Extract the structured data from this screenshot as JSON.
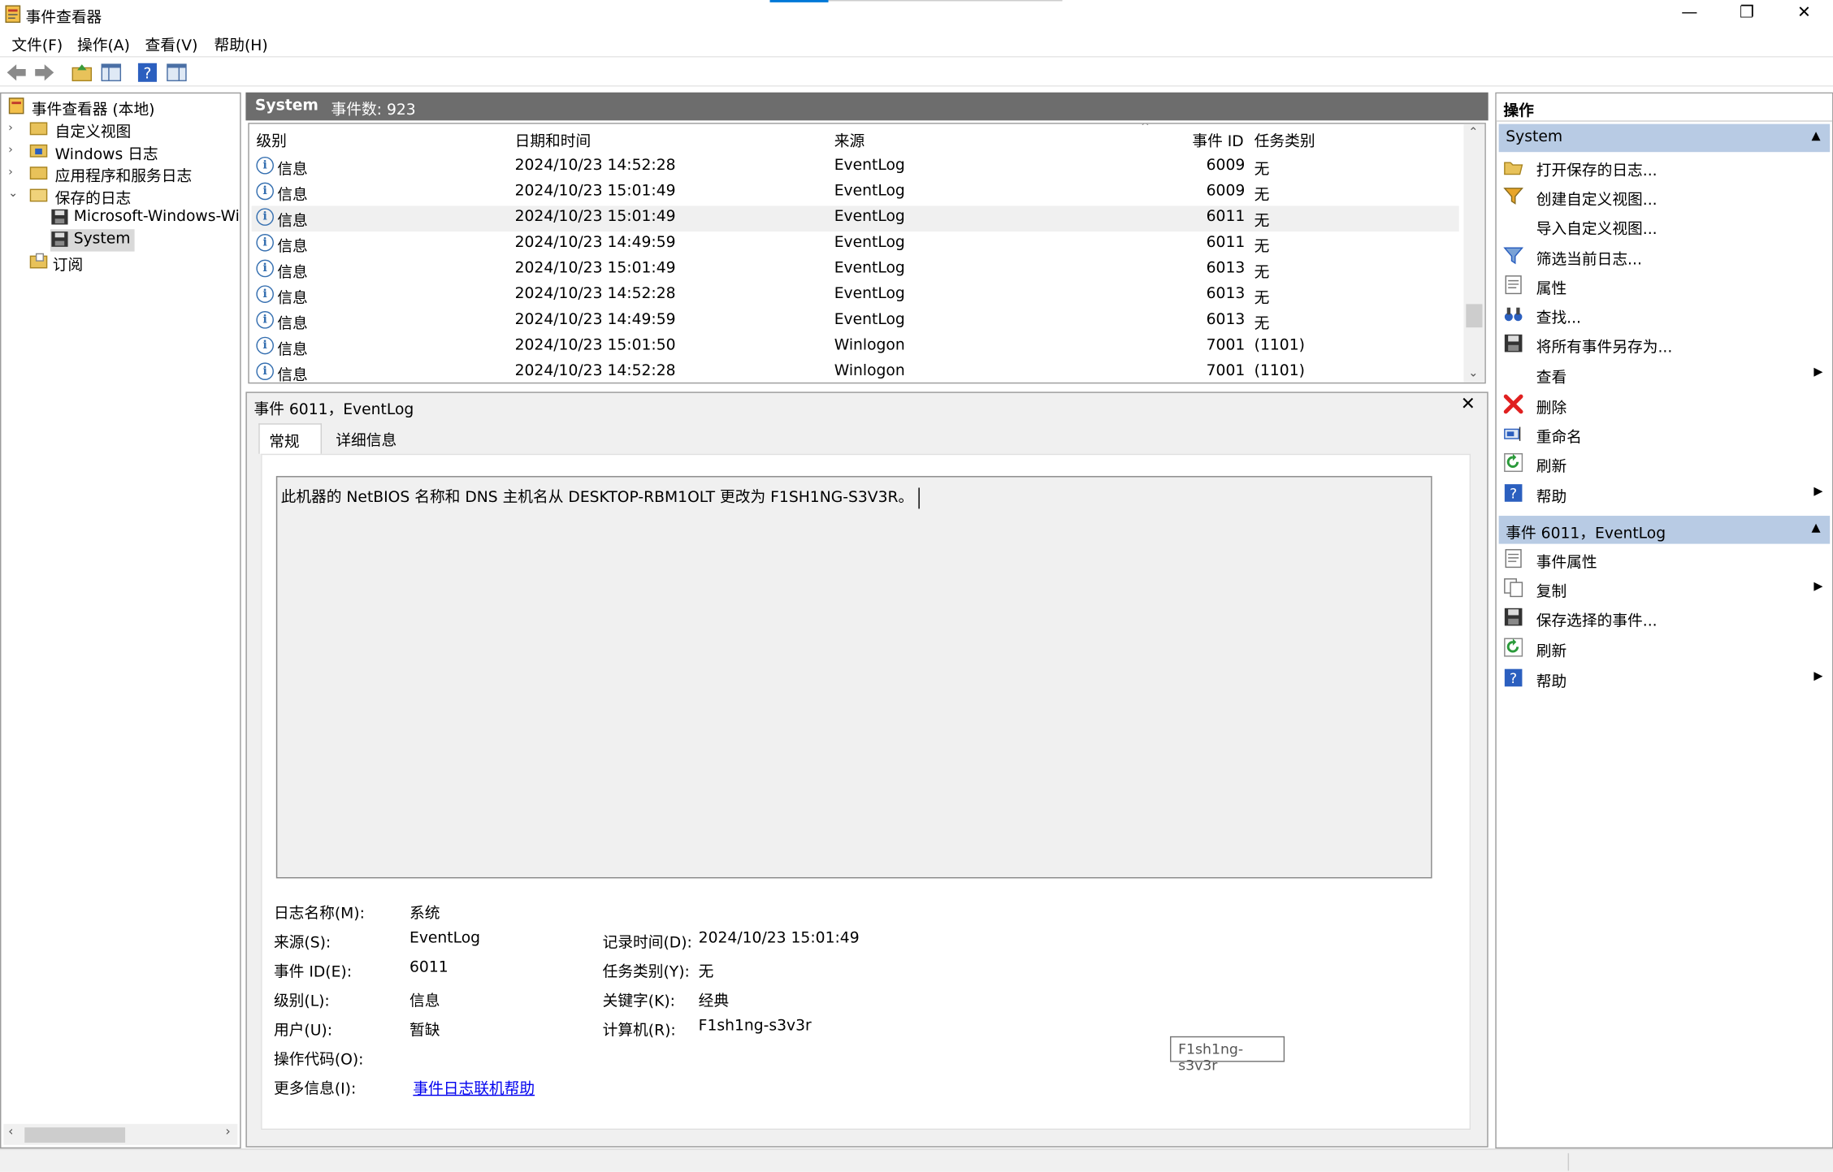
{
  "window": {
    "title": "事件查看器",
    "minimize": "—",
    "restore": "❐",
    "close": "✕"
  },
  "menu": [
    "文件(F)",
    "操作(A)",
    "查看(V)",
    "帮助(H)"
  ],
  "tree": {
    "root": "事件查看器 (本地)",
    "items": [
      "自定义视图",
      "Windows 日志",
      "应用程序和服务日志",
      "保存的日志",
      "Microsoft-Windows-Wir",
      "System",
      "订阅"
    ]
  },
  "list": {
    "name": "System",
    "count_label": "事件数: 923",
    "columns": [
      "级别",
      "日期和时间",
      "来源",
      "事件 ID",
      "任务类别"
    ],
    "rows": [
      {
        "level": "信息",
        "date": "2024/10/23 14:52:28",
        "source": "EventLog",
        "id": "6009",
        "task": "无"
      },
      {
        "level": "信息",
        "date": "2024/10/23 15:01:49",
        "source": "EventLog",
        "id": "6009",
        "task": "无"
      },
      {
        "level": "信息",
        "date": "2024/10/23 15:01:49",
        "source": "EventLog",
        "id": "6011",
        "task": "无"
      },
      {
        "level": "信息",
        "date": "2024/10/23 14:49:59",
        "source": "EventLog",
        "id": "6011",
        "task": "无"
      },
      {
        "level": "信息",
        "date": "2024/10/23 15:01:49",
        "source": "EventLog",
        "id": "6013",
        "task": "无"
      },
      {
        "level": "信息",
        "date": "2024/10/23 14:52:28",
        "source": "EventLog",
        "id": "6013",
        "task": "无"
      },
      {
        "level": "信息",
        "date": "2024/10/23 14:49:59",
        "source": "EventLog",
        "id": "6013",
        "task": "无"
      },
      {
        "level": "信息",
        "date": "2024/10/23 15:01:50",
        "source": "Winlogon",
        "id": "7001",
        "task": "(1101)"
      },
      {
        "level": "信息",
        "date": "2024/10/23 14:52:28",
        "source": "Winlogon",
        "id": "7001",
        "task": "(1101)"
      }
    ]
  },
  "detail": {
    "title": "事件 6011，EventLog",
    "close": "✕",
    "tabs": [
      "常规",
      "详细信息"
    ],
    "message": "此机器的 NetBIOS 名称和 DNS 主机名从 DESKTOP-RBM1OLT 更改为 F1SH1NG-S3V3R。",
    "props": {
      "log_name_label": "日志名称(M):",
      "log_name": "系统",
      "source_label": "来源(S):",
      "source": "EventLog",
      "logged_label": "记录时间(D):",
      "logged": "2024/10/23 15:01:49",
      "event_id_label": "事件 ID(E):",
      "event_id": "6011",
      "task_label": "任务类别(Y):",
      "task": "无",
      "level_label": "级别(L):",
      "level": "信息",
      "keywords_label": "关键字(K):",
      "keywords": "经典",
      "user_label": "用户(U):",
      "user": "暂缺",
      "computer_label": "计算机(R):",
      "computer": "F1sh1ng-s3v3r",
      "opcode_label": "操作代码(O):",
      "more_label": "更多信息(I):",
      "more_link": "事件日志联机帮助"
    },
    "tooltip": "F1sh1ng-s3v3r"
  },
  "actions": {
    "header": "操作",
    "section1": "System",
    "items1": [
      "打开保存的日志...",
      "创建自定义视图...",
      "导入自定义视图...",
      "筛选当前日志...",
      "属性",
      "查找...",
      "将所有事件另存为...",
      "查看",
      "删除",
      "重命名",
      "刷新",
      "帮助"
    ],
    "section2": "事件 6011，EventLog",
    "items2": [
      "事件属性",
      "复制",
      "保存选择的事件...",
      "刷新",
      "帮助"
    ]
  },
  "colors": {
    "accent": "#0078d7",
    "section_bg": "#b8cbe4",
    "list_header_bg": "#6d6d6d",
    "link": "#0000ee",
    "delete_red": "#e02020"
  }
}
